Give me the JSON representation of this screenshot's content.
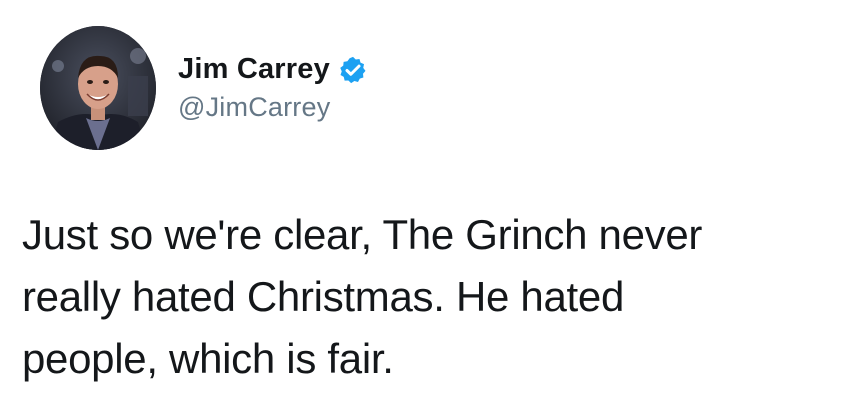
{
  "author": {
    "display_name": "Jim Carrey",
    "handle": "@JimCarrey",
    "verified": true,
    "verified_color": "#1da1f2"
  },
  "tweet": {
    "lines": [
      "Just so we're clear, The Grinch never",
      "really hated Christmas. He hated",
      "people, which is fair."
    ]
  },
  "icons": {
    "verified": "verified-badge-icon",
    "avatar": "profile-photo"
  }
}
